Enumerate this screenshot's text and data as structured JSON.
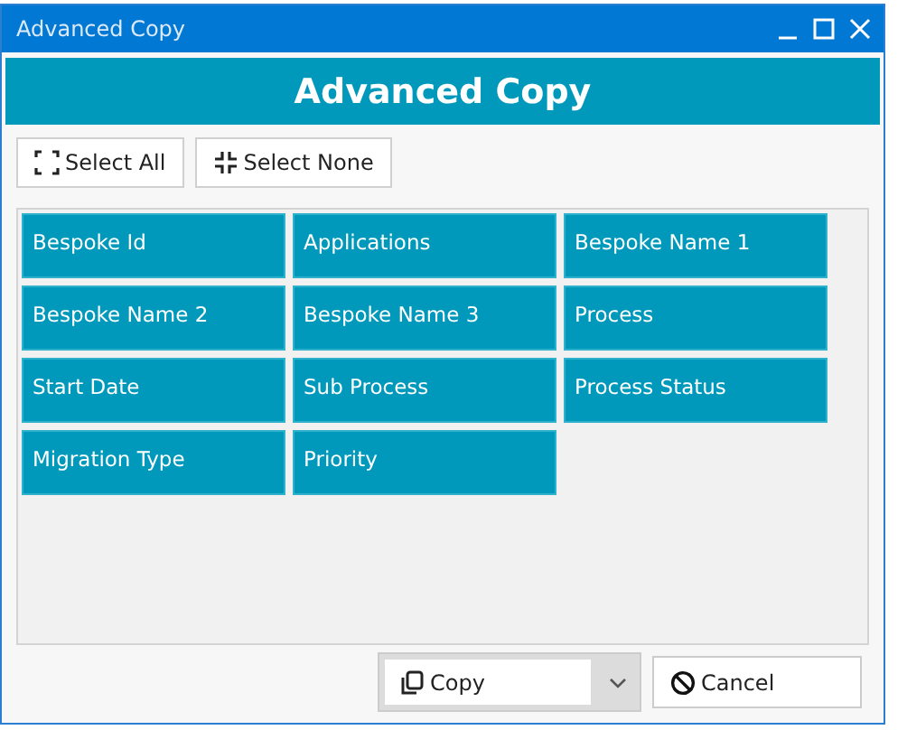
{
  "window": {
    "title": "Advanced Copy"
  },
  "header": {
    "title": "Advanced Copy"
  },
  "toolbar": [
    {
      "kind": "select_all",
      "label": "Select All"
    },
    {
      "kind": "select_none",
      "label": "Select None"
    }
  ],
  "fields": [
    "Bespoke Id",
    "Applications",
    "Bespoke Name 1",
    "Bespoke Name 2",
    "Bespoke Name 3",
    "Process",
    "Start Date",
    "Sub Process",
    "Process Status",
    "Migration Type",
    "Priority"
  ],
  "footer": {
    "copy": "Copy",
    "cancel": "Cancel"
  }
}
